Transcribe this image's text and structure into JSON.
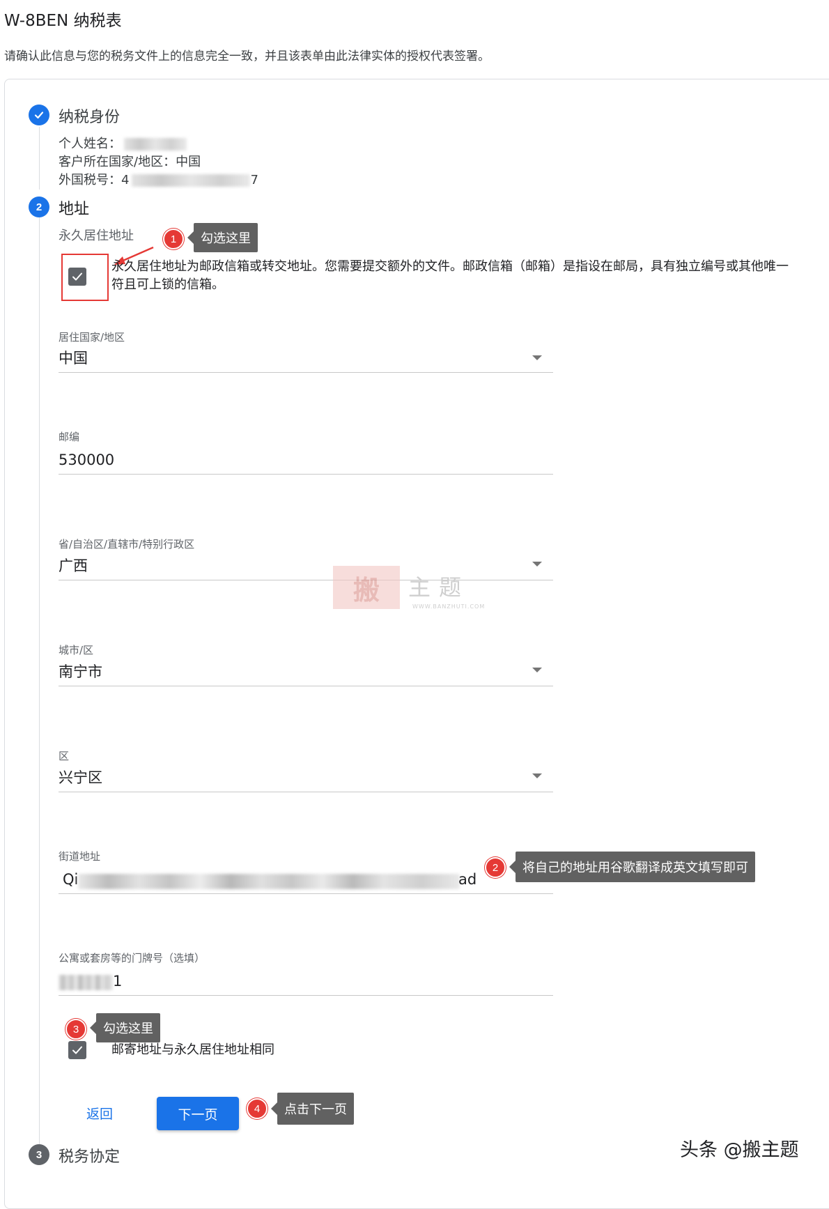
{
  "header": {
    "title": "W-8BEN 纳税表",
    "subtitle": "请确认此信息与您的税务文件上的信息完全一致，并且该表单由此法律实体的授权代表签署。"
  },
  "steps": {
    "tax_identity": {
      "title": "纳税身份",
      "name_label": "个人姓名：",
      "country_label": "客户所在国家/地区：",
      "country_value": "中国",
      "tax_id_label": "外国税号：",
      "tax_id_prefix": "4",
      "tax_id_suffix": "7"
    },
    "address": {
      "number": "2",
      "title": "地址",
      "permanent_label": "永久居住地址",
      "po_box_text_line1": "永久居住地址为邮政信箱或转交地址。您需要提交额外的文件。邮政信箱（邮箱）是指设在邮局，具有独立编号或其他唯一",
      "po_box_text_line2": "符且可上锁的信箱。",
      "fields": {
        "country": {
          "label": "居住国家/地区",
          "value": "中国"
        },
        "postal": {
          "label": "邮编",
          "value": "530000"
        },
        "province": {
          "label": "省/自治区/直辖市/特别行政区",
          "value": "广西"
        },
        "city": {
          "label": "城市/区",
          "value": "南宁市"
        },
        "district": {
          "label": "区",
          "value": "兴宁区"
        },
        "street": {
          "label": "街道地址",
          "prefix": "Qi",
          "suffix": "ad"
        },
        "apartment": {
          "label": "公寓或套房等的门牌号（选填）",
          "suffix": "1"
        }
      },
      "mailing_same_label": "邮寄地址与永久居住地址相同",
      "back_label": "返回",
      "next_label": "下一页"
    },
    "tax_treaty": {
      "number": "3",
      "title": "税务协定"
    }
  },
  "annotations": [
    {
      "number": "1",
      "text": "勾选这里"
    },
    {
      "number": "2",
      "text": "将自己的地址用谷歌翻译成英文填写即可"
    },
    {
      "number": "3",
      "text": "勾选这里"
    },
    {
      "number": "4",
      "text": "点击下一页"
    }
  ],
  "watermark": {
    "seal": "搬",
    "text": "主题",
    "url": "WWW.BANZHUTI.COM"
  },
  "footer": {
    "credit": "头条 @搬主题"
  },
  "colors": {
    "primary": "#1a73e8",
    "annotation_red": "#e53935",
    "tooltip_grey": "#616161",
    "checkbox_grey": "#5f6368"
  }
}
